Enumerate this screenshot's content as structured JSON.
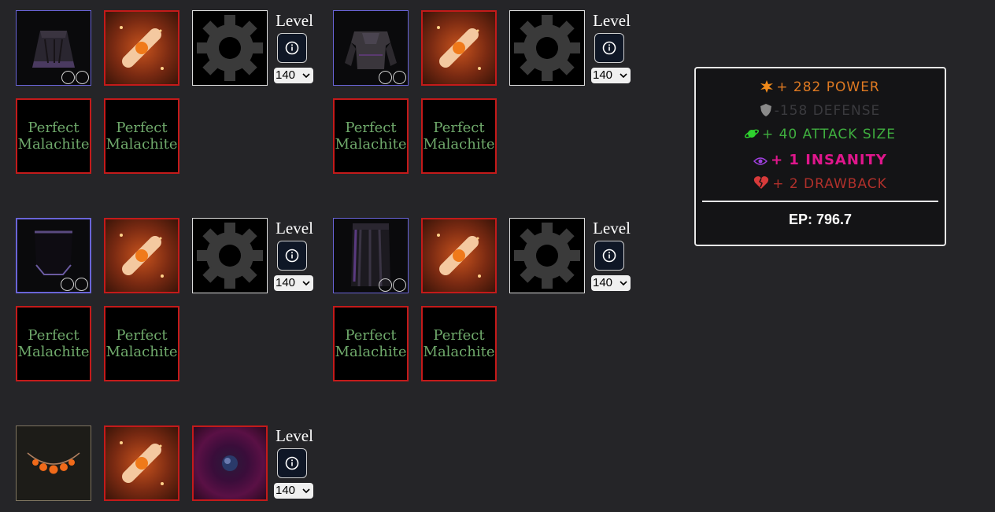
{
  "builds": [
    {
      "item": "robe-icon",
      "gems": [
        "Perfect\nMalachite",
        "Perfect\nMalachite"
      ],
      "level_label": "Level",
      "level_value": "140"
    },
    {
      "item": "chest-armor-icon",
      "gems": [
        "Perfect\nMalachite",
        "Perfect\nMalachite"
      ],
      "level_label": "Level",
      "level_value": "140"
    },
    {
      "item": "cape-icon",
      "gems": [
        "Perfect\nMalachite",
        "Perfect\nMalachite"
      ],
      "level_label": "Level",
      "level_value": "140"
    },
    {
      "item": "legs-icon",
      "gems": [
        "Perfect\nMalachite",
        "Perfect\nMalachite"
      ],
      "level_label": "Level",
      "level_value": "140"
    },
    {
      "item": "necklace-icon",
      "level_label": "Level",
      "level_value": "140"
    }
  ],
  "gem_line1": "Perfect",
  "gem_line2": "Malachite",
  "stats": {
    "power": "+ 282 POWER",
    "defense": "-158 DEFENSE",
    "attack_size": "+ 40 ATTACK SIZE",
    "insanity": "+ 1 INSANITY",
    "drawback": "+ 2 DRAWBACK",
    "ep": "EP: 796.7"
  },
  "colors": {
    "power": "#e07a22",
    "defense": "#3a3a3e",
    "attack_size": "#3fae3f",
    "insanity": "#e0168c",
    "drawback": "#b0302b",
    "slot_border_red": "#c41a1a",
    "item_border": "#6a64d8"
  }
}
